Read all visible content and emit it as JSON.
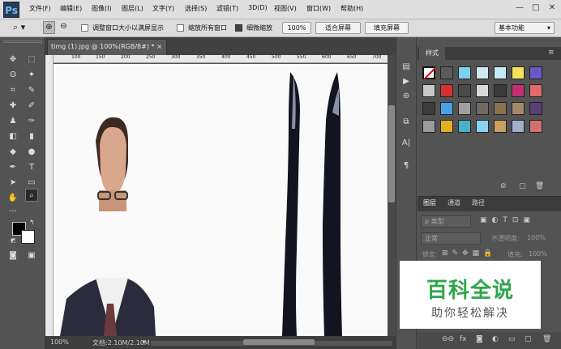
{
  "app": {
    "logo": "Ps"
  },
  "menu": [
    "文件(F)",
    "编辑(E)",
    "图像(I)",
    "图层(L)",
    "文字(Y)",
    "选择(S)",
    "滤镜(T)",
    "3D(D)",
    "视图(V)",
    "窗口(W)",
    "帮助(H)"
  ],
  "window_controls": {
    "minimize": "—",
    "restore": "□",
    "close": "✕"
  },
  "options": {
    "resize_windows": "调整窗口大小以满屏显示",
    "zoom_all": "缩放所有窗口",
    "scrubby_zoom": "细微缩放",
    "zoom_value": "100%",
    "fit_screen": "适合屏幕",
    "fill_screen": "填充屏幕",
    "workspace": "基本功能",
    "scrubby_checked": true
  },
  "document": {
    "tab_title": "timg (1).jpg @ 100%(RGB/8#) *",
    "tab_close": "×",
    "ruler_labels": [
      "100",
      "150",
      "200",
      "250",
      "300",
      "350",
      "400",
      "450",
      "500",
      "550",
      "600",
      "650",
      "700"
    ]
  },
  "status": {
    "zoom": "100%",
    "doc_info": "文档:2.10M/2.10M"
  },
  "styles_panel": {
    "tab": "样式"
  },
  "layers_panel": {
    "tabs": [
      "图层",
      "通道",
      "路径"
    ],
    "filter_label": "ρ 类型",
    "blend_mode": "正常",
    "opacity_label": "不透明度:",
    "opacity_value": "100%",
    "lock_label": "锁定:",
    "fill_label": "填充:",
    "fill_value": "100%"
  },
  "watermark": {
    "title": "百科全说",
    "subtitle": "助你轻松解决"
  },
  "colors": {
    "accent": "#2ea64a",
    "ps_blue": "#66b6ff",
    "panel_bg": "#535353"
  }
}
